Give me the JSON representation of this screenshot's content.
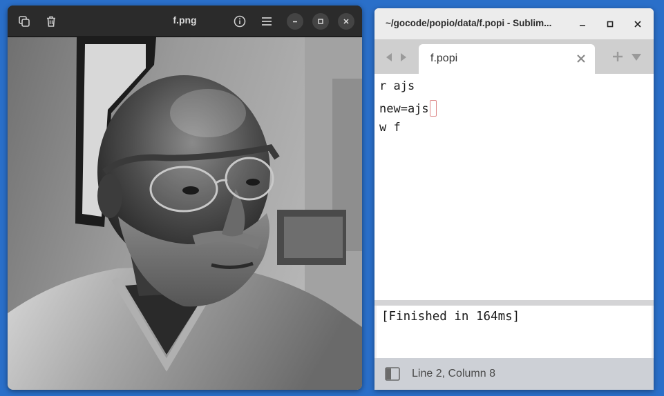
{
  "viewer": {
    "title": "f.png",
    "icons": {
      "copy": "copy-icon",
      "delete": "trash-icon",
      "info": "info-icon",
      "menu": "hamburger-menu-icon",
      "minimize": "minimize-icon",
      "maximize": "maximize-icon",
      "close": "close-icon"
    },
    "image_subject": "photo"
  },
  "sublime": {
    "window_title": "~/gocode/popio/data/f.popi - Sublim...",
    "tab": {
      "label": "f.popi"
    },
    "code": {
      "line1": "r ajs",
      "line2": "new=ajs",
      "line3": "w f"
    },
    "output": "[Finished in 164ms]",
    "status": "Line 2, Column 8"
  },
  "colors": {
    "desktop": "#2a6fc9",
    "viewer_header": "#2b2b2b",
    "sublime_tabbar": "#cfcfcf",
    "statusbar": "#cdd0d6",
    "cursor_outline": "#dd8888"
  }
}
